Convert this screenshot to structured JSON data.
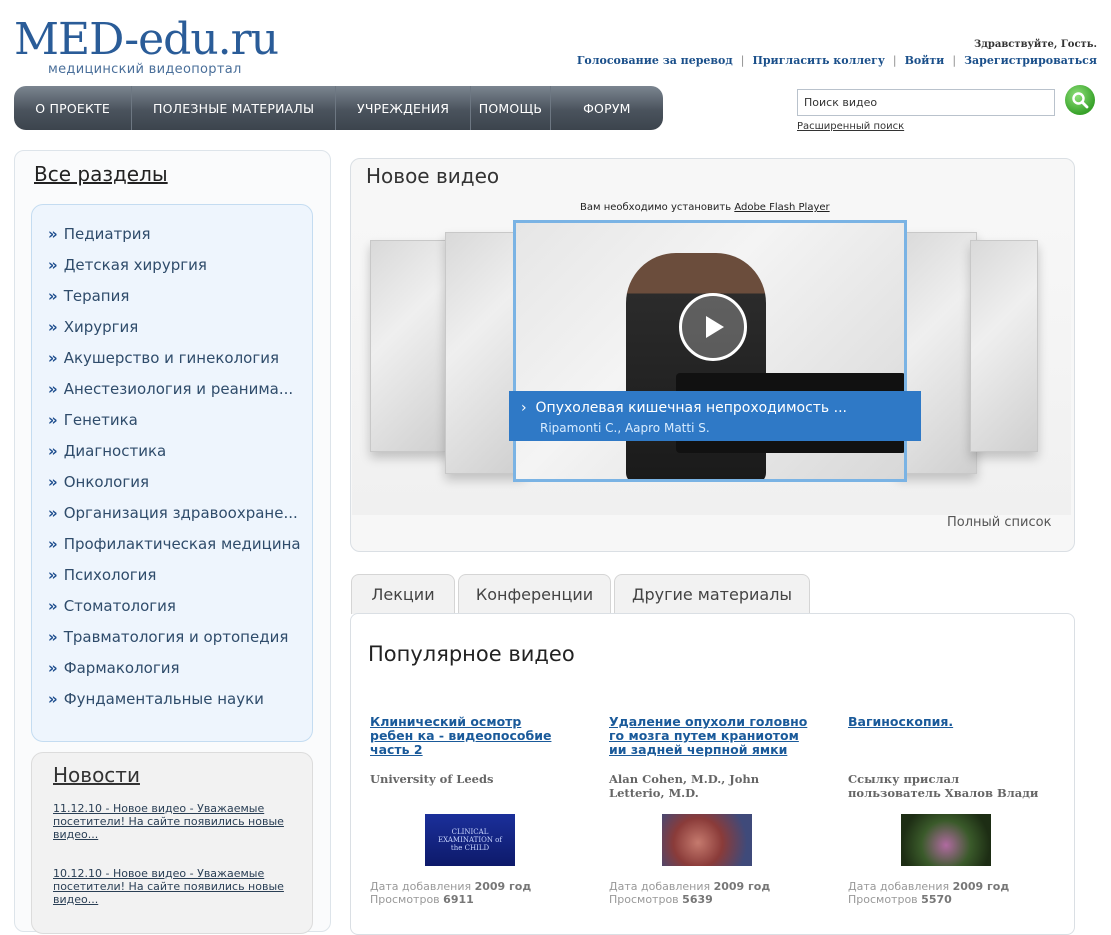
{
  "header": {
    "logo_main": "MED-edu.ru",
    "logo_sub": "медицинский видеопортал",
    "greeting": "Здравствуйте, Гость.",
    "links": [
      "Голосование за перевод",
      "Пригласить коллегу",
      "Войти",
      "Зарегистрироваться"
    ]
  },
  "nav": {
    "items": [
      "О ПРОЕКТЕ",
      "ПОЛЕЗНЫЕ МАТЕРИАЛЫ",
      "УЧРЕЖДЕНИЯ",
      "ПОМОЩЬ",
      "ФОРУМ"
    ]
  },
  "search": {
    "value": "Поиск видео",
    "advanced": "Расширенный поиск",
    "icon": "magnifier-icon"
  },
  "sidebar": {
    "title": "Все разделы",
    "arrow": "»",
    "categories": [
      "Педиатрия",
      "Детская хирургия",
      "Терапия",
      "Хирургия",
      "Акушерство и гинекология",
      "Анестезиология и реанима...",
      "Генетика",
      "Диагностика",
      "Онкология",
      "Организация здравоохране...",
      "Профилактическая медицина",
      "Психология",
      "Стоматология",
      "Травматология и ортопедия",
      "Фармакология",
      "Фундаментальные науки"
    ],
    "news_title": "Новости",
    "news": [
      "11.12.10 - Новое видео - Уважаемые посетители! На сайте появились новые видео...",
      "10.12.10 - Новое видео - Уважаемые посетители! На сайте появились новые видео..."
    ]
  },
  "new_video": {
    "title": "Новое видео",
    "flash_prefix": "Вам необходимо установить",
    "flash_link": "Adobe Flash Player",
    "caption_arrow": "›",
    "caption_title": "Опухолевая кишечная непроходимость ...",
    "caption_author": "Ripamonti C., Aapro Matti S.",
    "full_list": "Полный список"
  },
  "tabs": [
    "Лекции",
    "Конференции",
    "Другие материалы"
  ],
  "popular": {
    "title": "Популярное видео",
    "date_label": "Дата добавления",
    "views_label": "Просмотров",
    "videos": [
      {
        "title": "Клинический осмотр ребен ка - видеопособие часть 2",
        "author": "University of Leeds",
        "date": "2009 год",
        "views": "6911",
        "thumb_text": "CLINICAL EXAMINATION of the CHILD"
      },
      {
        "title": "Удаление опухоли головно го мозга путем краниотом ии задней черпной ямки",
        "author": "Alan Cohen, M.D., John Letterio, M.D.",
        "date": "2009 год",
        "views": "5639",
        "thumb_text": ""
      },
      {
        "title": "Вагиноскопия.",
        "author": "Ссылку прислал пользователь Хвалов Влади",
        "date": "2009 год",
        "views": "5570",
        "thumb_text": ""
      }
    ]
  },
  "colors": {
    "link": "#1a4f8a",
    "nav_bg": "#4a535d",
    "accent_blue": "#2f79c6",
    "search_green": "#38a22a"
  }
}
